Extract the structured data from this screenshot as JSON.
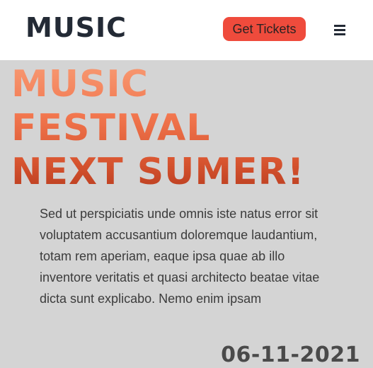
{
  "header": {
    "logo": "MUSIC",
    "tickets_label": "Get Tickets",
    "menu_icon": "hamburger-menu-icon"
  },
  "hero": {
    "title_lines": [
      "MUSIC",
      "FESTIVAL",
      "NEXT SUMER!"
    ],
    "description": "Sed ut perspiciatis unde omnis iste natus error sit voluptatem accusantium doloremque laudantium, totam rem aperiam, eaque ipsa quae ab illo inventore veritatis et quasi architecto beatae vitae dicta sunt explicabo. Nemo enim ipsam",
    "date": "06-11-2021"
  },
  "colors": {
    "accent": "#ef4b3c",
    "header_bg": "#ffffff",
    "page_bg": "#d4d4d4",
    "logo": "#232a35"
  }
}
